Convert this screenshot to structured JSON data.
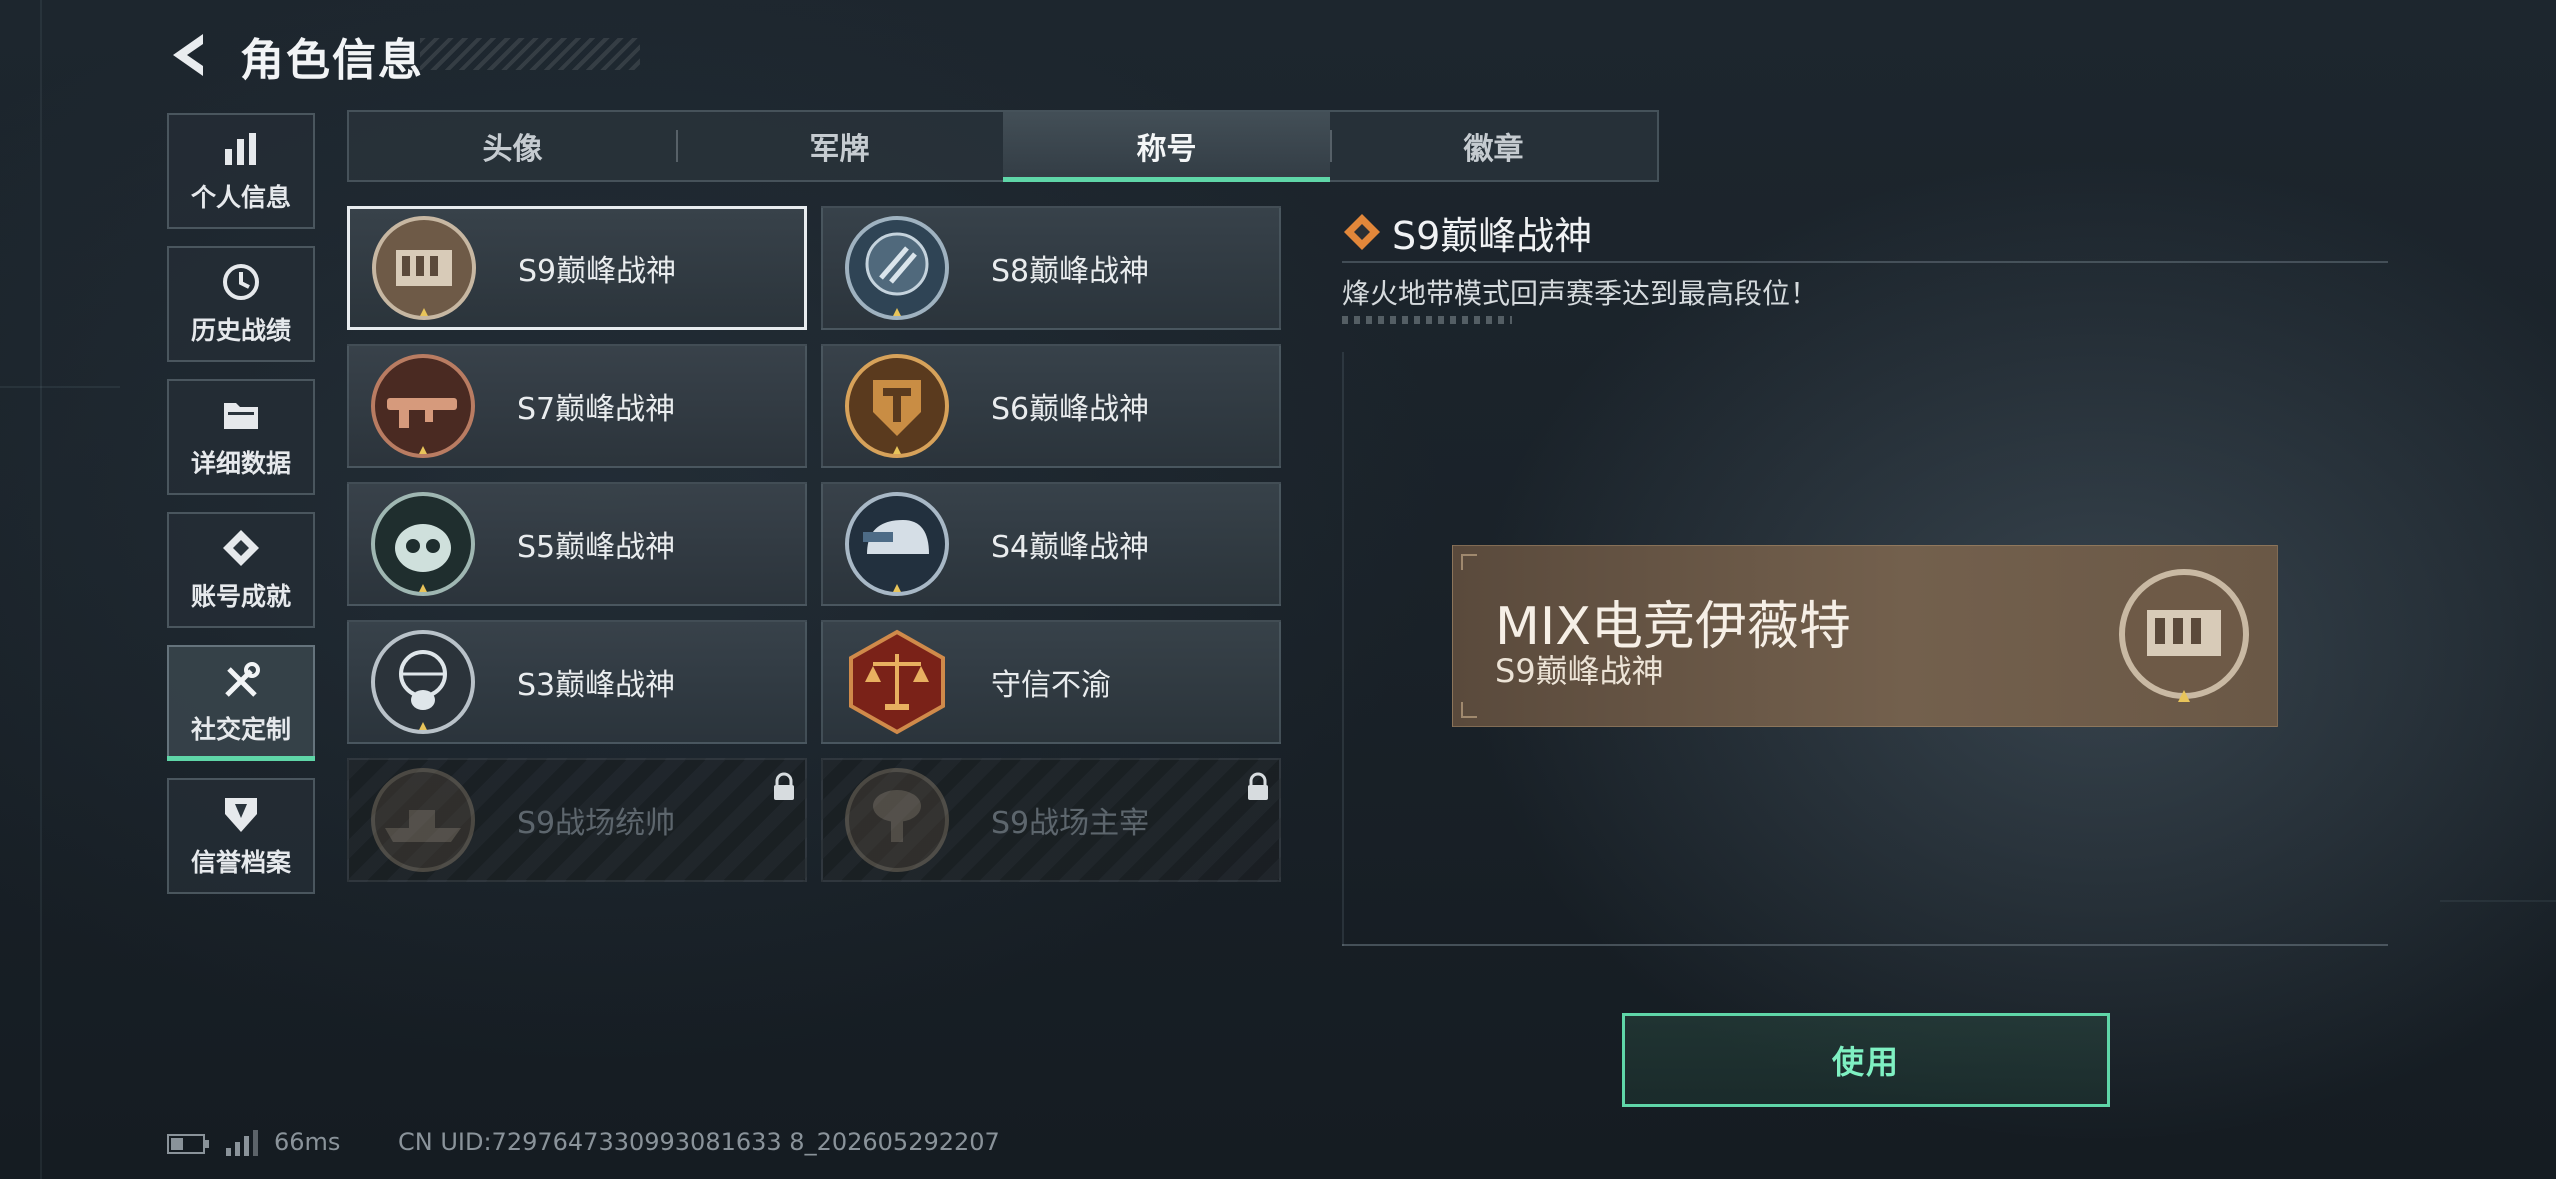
{
  "header": {
    "title": "角色信息",
    "back_icon": "back-arrow-icon"
  },
  "sidebar": {
    "items": [
      {
        "label": "个人信息",
        "icon": "bar-chart-icon",
        "active": false
      },
      {
        "label": "历史战绩",
        "icon": "history-clock-icon",
        "active": false
      },
      {
        "label": "详细数据",
        "icon": "folder-icon",
        "active": false
      },
      {
        "label": "账号成就",
        "icon": "achievement-icon",
        "active": false
      },
      {
        "label": "社交定制",
        "icon": "tools-icon",
        "active": true
      },
      {
        "label": "信誉档案",
        "icon": "reputation-icon",
        "active": false
      }
    ]
  },
  "tabs": [
    {
      "label": "头像",
      "active": false
    },
    {
      "label": "军牌",
      "active": false
    },
    {
      "label": "称号",
      "active": true
    },
    {
      "label": "徽章",
      "active": false
    }
  ],
  "titles": [
    {
      "name": "S9巅峰战神",
      "emblem": "fortress-emblem-icon",
      "selected": true,
      "locked": false
    },
    {
      "name": "S8巅峰战神",
      "emblem": "shield-stripes-emblem-icon",
      "selected": false,
      "locked": false
    },
    {
      "name": "S7巅峰战神",
      "emblem": "rifle-emblem-icon",
      "selected": false,
      "locked": false
    },
    {
      "name": "S6巅峰战神",
      "emblem": "t-shield-emblem-icon",
      "selected": false,
      "locked": false
    },
    {
      "name": "S5巅峰战神",
      "emblem": "diver-skull-emblem-icon",
      "selected": false,
      "locked": false
    },
    {
      "name": "S4巅峰战神",
      "emblem": "helmet-emblem-icon",
      "selected": false,
      "locked": false
    },
    {
      "name": "S3巅峰战神",
      "emblem": "globe-skull-emblem-icon",
      "selected": false,
      "locked": false
    },
    {
      "name": "守信不渝",
      "emblem": "scales-emblem-icon",
      "selected": false,
      "locked": false
    },
    {
      "name": "S9战场统帅",
      "emblem": "warship-emblem-icon",
      "selected": false,
      "locked": true
    },
    {
      "name": "S9战场主宰",
      "emblem": "mushroom-cloud-emblem-icon",
      "selected": false,
      "locked": true
    }
  ],
  "detail": {
    "title": "S9巅峰战神",
    "description": "烽火地带模式回声赛季达到最高段位！",
    "nameplate": {
      "player_name": "MIX电竞伊薇特",
      "title": "S9巅峰战神"
    },
    "use_button": "使用"
  },
  "status_bar": {
    "ping": "66ms",
    "uid": "CN UID:7297647330993081633 8_202605292207"
  },
  "colors": {
    "accent": "#5fd6a8",
    "nameplate": "#6e5b48"
  }
}
